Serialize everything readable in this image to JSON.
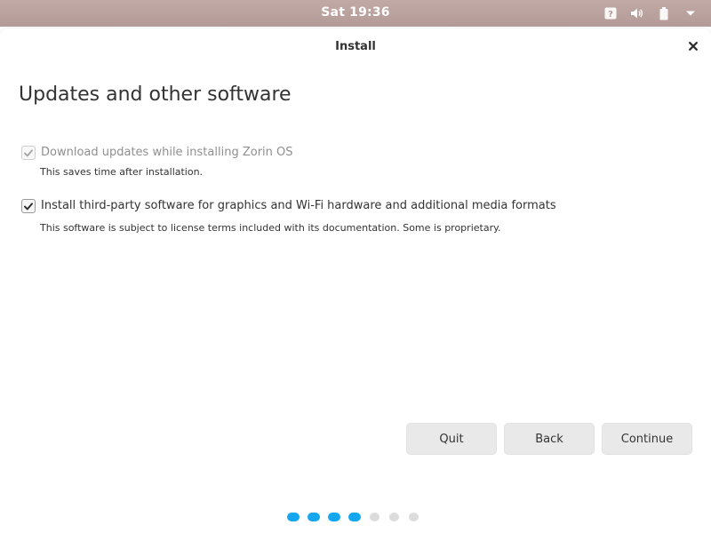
{
  "panel": {
    "clock": "Sat 19:36"
  },
  "window": {
    "title": "Install",
    "close_glyph": "×"
  },
  "page": {
    "heading": "Updates and other software"
  },
  "options": [
    {
      "label": "Download updates while installing Zorin OS",
      "description": "This saves time after installation.",
      "checked": true,
      "disabled": true
    },
    {
      "label": "Install third-party software for graphics and Wi-Fi hardware and additional media formats",
      "description": "This software is subject to license terms included with its documentation. Some is proprietary.",
      "checked": true,
      "disabled": false
    }
  ],
  "buttons": {
    "quit": "Quit",
    "back": "Back",
    "continue": "Continue"
  },
  "progress": {
    "completed": 4,
    "total": 7
  },
  "colors": {
    "accent": "#15a6f0",
    "panel": "#b8a09c"
  },
  "icons": {
    "tray": [
      "help-icon",
      "volume-icon",
      "battery-icon",
      "system-menu-arrow-icon"
    ]
  }
}
